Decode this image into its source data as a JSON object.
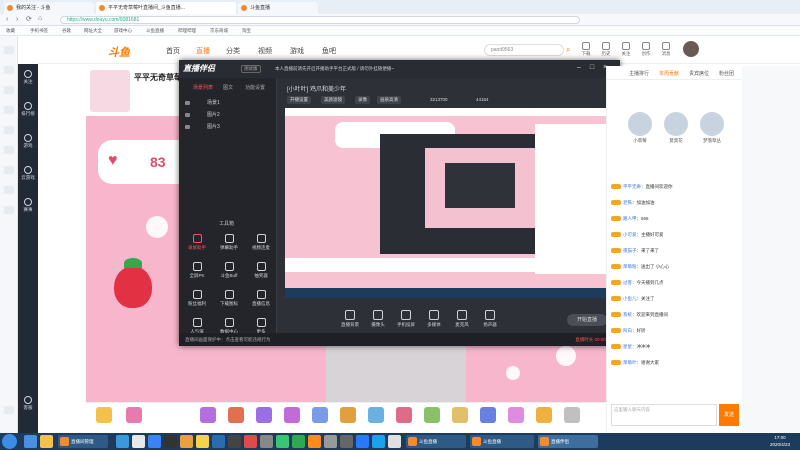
{
  "browser": {
    "tabs": [
      {
        "label": "我的关注 - 斗鱼"
      },
      {
        "label": "平平无奇草莓叶直播间_斗鱼直播..."
      },
      {
        "label": "斗鱼直播"
      }
    ],
    "url": "https://www.douyu.com/9081681",
    "bookmarks": [
      "收藏",
      "手机书签",
      "谷歌",
      "网址大全",
      "游戏中心",
      "斗鱼直播",
      "哔哩哔哩",
      "京东商城",
      "淘宝"
    ]
  },
  "site": {
    "logo": "斗鱼",
    "nav": [
      {
        "label": "首页"
      },
      {
        "label": "直播",
        "active": true
      },
      {
        "label": "分类"
      },
      {
        "label": "视频"
      },
      {
        "label": "游戏"
      },
      {
        "label": "鱼吧"
      }
    ],
    "search_placeholder": "pand9563",
    "header_icons": [
      "下载",
      "历史",
      "关注",
      "创作",
      "消息"
    ],
    "left_nav": [
      "关注",
      "排行榜",
      "游戏",
      "云游戏",
      "赛事",
      "客服"
    ]
  },
  "stream": {
    "title": "平平无奇草莓叶",
    "heart_count": "83"
  },
  "capture_app": {
    "title": "直播伴侣",
    "version": "测试版",
    "notice": "本人直播前请先开启开播助手平台正式版 / 请勿外挂随便播~",
    "left_tabs": [
      "场景列表",
      "图文",
      "功能设置"
    ],
    "scenes": [
      "场景1",
      "图片2",
      "图片3"
    ],
    "tools_label": "工具箱",
    "tools": [
      "录屏助手",
      "弹幕助手",
      "视频连麦",
      "全屏PK",
      "斗鱼Buff",
      "抽奖器",
      "粉丝福利",
      "下载图标",
      "直播信息",
      "人气值",
      "数据中心",
      "更多"
    ],
    "room_line": "[小叶叶] 鸡爪和美少年",
    "pills": [
      "开播设置",
      "美颜滤镜",
      "录像",
      "画质高清",
      "3213700",
      "44154"
    ],
    "bottom_tools": [
      "直播背景",
      "摄像头",
      "手机投屏",
      "多媒体",
      "麦克风",
      "扬声器"
    ],
    "start_label": "开始直播",
    "footer": "直播间画面保护中：点击查看可能违规行为",
    "footer_right": "直播时长 00:00:00"
  },
  "chat": {
    "tabs": [
      "主播排行",
      "本周贡献",
      "贵宾席位",
      "粉丝团"
    ],
    "rank": [
      {
        "name": "小草莓"
      },
      {
        "name": "莫莫花"
      },
      {
        "name": "梦落草丛"
      }
    ],
    "messages": [
      {
        "user": "平平无奇",
        "text": "直播间欢迎你"
      },
      {
        "user": "老铁",
        "text": "加油加油"
      },
      {
        "user": "路人甲",
        "text": "666"
      },
      {
        "user": "小可爱",
        "text": "主播好可爱"
      },
      {
        "user": "夜猫子",
        "text": "来了来了"
      },
      {
        "user": "草莓粉",
        "text": "送出了 小心心"
      },
      {
        "user": "过客",
        "text": "今天播到几点"
      },
      {
        "user": "小鱼儿",
        "text": "关注了"
      },
      {
        "user": "系统",
        "text": "欢迎来到直播间"
      },
      {
        "user": "阿白",
        "text": "好听"
      },
      {
        "user": "星星",
        "text": "冲冲冲"
      },
      {
        "user": "草莓叶",
        "text": "谢谢大家"
      }
    ],
    "input_placeholder": "这里输入聊天内容",
    "send_label": "发送"
  },
  "taskbar": {
    "items": [
      "直播间管理",
      "斗鱼直播",
      "直播伴侣"
    ],
    "clock_time": "17:00",
    "clock_date": "2020/4/23"
  },
  "colors": {
    "accent": "#ff7a00",
    "video_bg": "#f8b6cc",
    "app_bg": "#2a2c33"
  }
}
